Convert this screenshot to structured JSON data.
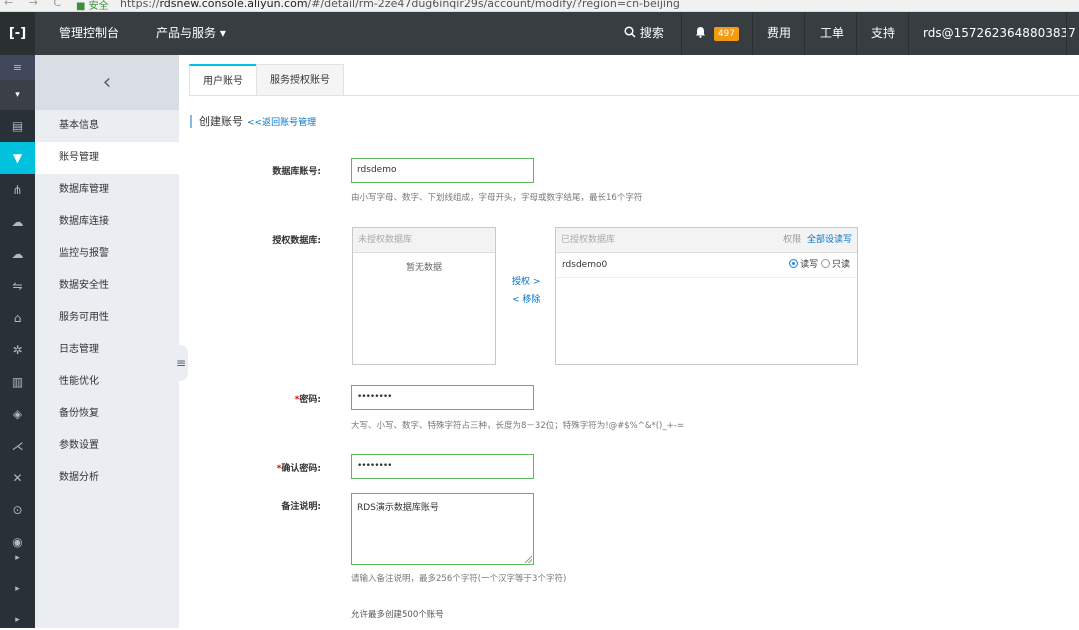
{
  "browser": {
    "nav": "← → C",
    "secure_label": "■ 安全",
    "url_prefix": "https://",
    "url_host": "rdsnew.console.aliyun.com",
    "url_path": "/#/detail/rm-2ze47dug6inqir29s/account/modify/?region=cn-beijing"
  },
  "topbar": {
    "logo": "[-]",
    "console": "管理控制台",
    "products": "产品与服务",
    "products_caret": "▾",
    "search": "搜索",
    "notification_count": "497",
    "billing": "费用",
    "tickets": "工单",
    "support": "支持",
    "user": "rds@1572623648803837"
  },
  "rail": {
    "menu_glyph": "≡",
    "caret": "▾",
    "icons": [
      "server-icon",
      "account-icon",
      "database-icon",
      "connection-icon",
      "monitor-icon",
      "security-icon",
      "availability-icon",
      "log-icon",
      "performance-icon",
      "backup-icon",
      "params-icon",
      "analysis-icon",
      "search-circle-icon",
      "eye-icon",
      "arrow-right-icon",
      "arrow-right-icon",
      "arrow-right-icon"
    ]
  },
  "sidebar": {
    "collapse_glyph": "‹",
    "grip_glyph": "≡",
    "items": [
      {
        "label": "基本信息"
      },
      {
        "label": "账号管理"
      },
      {
        "label": "数据库管理"
      },
      {
        "label": "数据库连接"
      },
      {
        "label": "监控与报警"
      },
      {
        "label": "数据安全性"
      },
      {
        "label": "服务可用性"
      },
      {
        "label": "日志管理"
      },
      {
        "label": "性能优化"
      },
      {
        "label": "备份恢复"
      },
      {
        "label": "参数设置"
      },
      {
        "label": "数据分析"
      }
    ]
  },
  "tabs": [
    {
      "label": "用户账号"
    },
    {
      "label": "服务授权账号"
    }
  ],
  "section": {
    "title": "创建账号",
    "back_link": "<<返回账号管理"
  },
  "form": {
    "account_label": "数据库账号:",
    "account_value": "rdsdemo",
    "account_hint": "由小写字母、数字、下划线组成，字母开头，字母或数字结尾，最长16个字符",
    "authdb_label": "授权数据库:",
    "unauth_header": "未授权数据库",
    "unauth_empty": "暂无数据",
    "grant_link": "授权 >",
    "remove_link": "< 移除",
    "auth_header": "已授权数据库",
    "perm_label": "权限",
    "set_all_rw": "全部设读写",
    "auth_rows": [
      {
        "name": "rdsdemo0",
        "rw_label": "读写",
        "ro_label": "只读",
        "selected": "读写"
      }
    ],
    "password_req": "*",
    "password_label": "密码:",
    "password_value": "••••••••",
    "password_hint": "大写、小写、数字、特殊字符占三种，长度为8－32位；特殊字符为!@#$%^&*()_+-=",
    "confirm_req": "*",
    "confirm_label": "确认密码:",
    "confirm_value": "••••••••",
    "remark_label": "备注说明:",
    "remark_value": "RDS演示数据库账号",
    "remark_hint": "请输入备注说明，最多256个字符(一个汉字等于3个字符)",
    "limit_note": "允许最多创建500个账号"
  },
  "colors": {
    "topbar": "#373d41",
    "rail": "#293038",
    "accent": "#00c1de",
    "badge": "#f39c12",
    "valid_border": "#5cb85c",
    "link": "#0077cc"
  }
}
